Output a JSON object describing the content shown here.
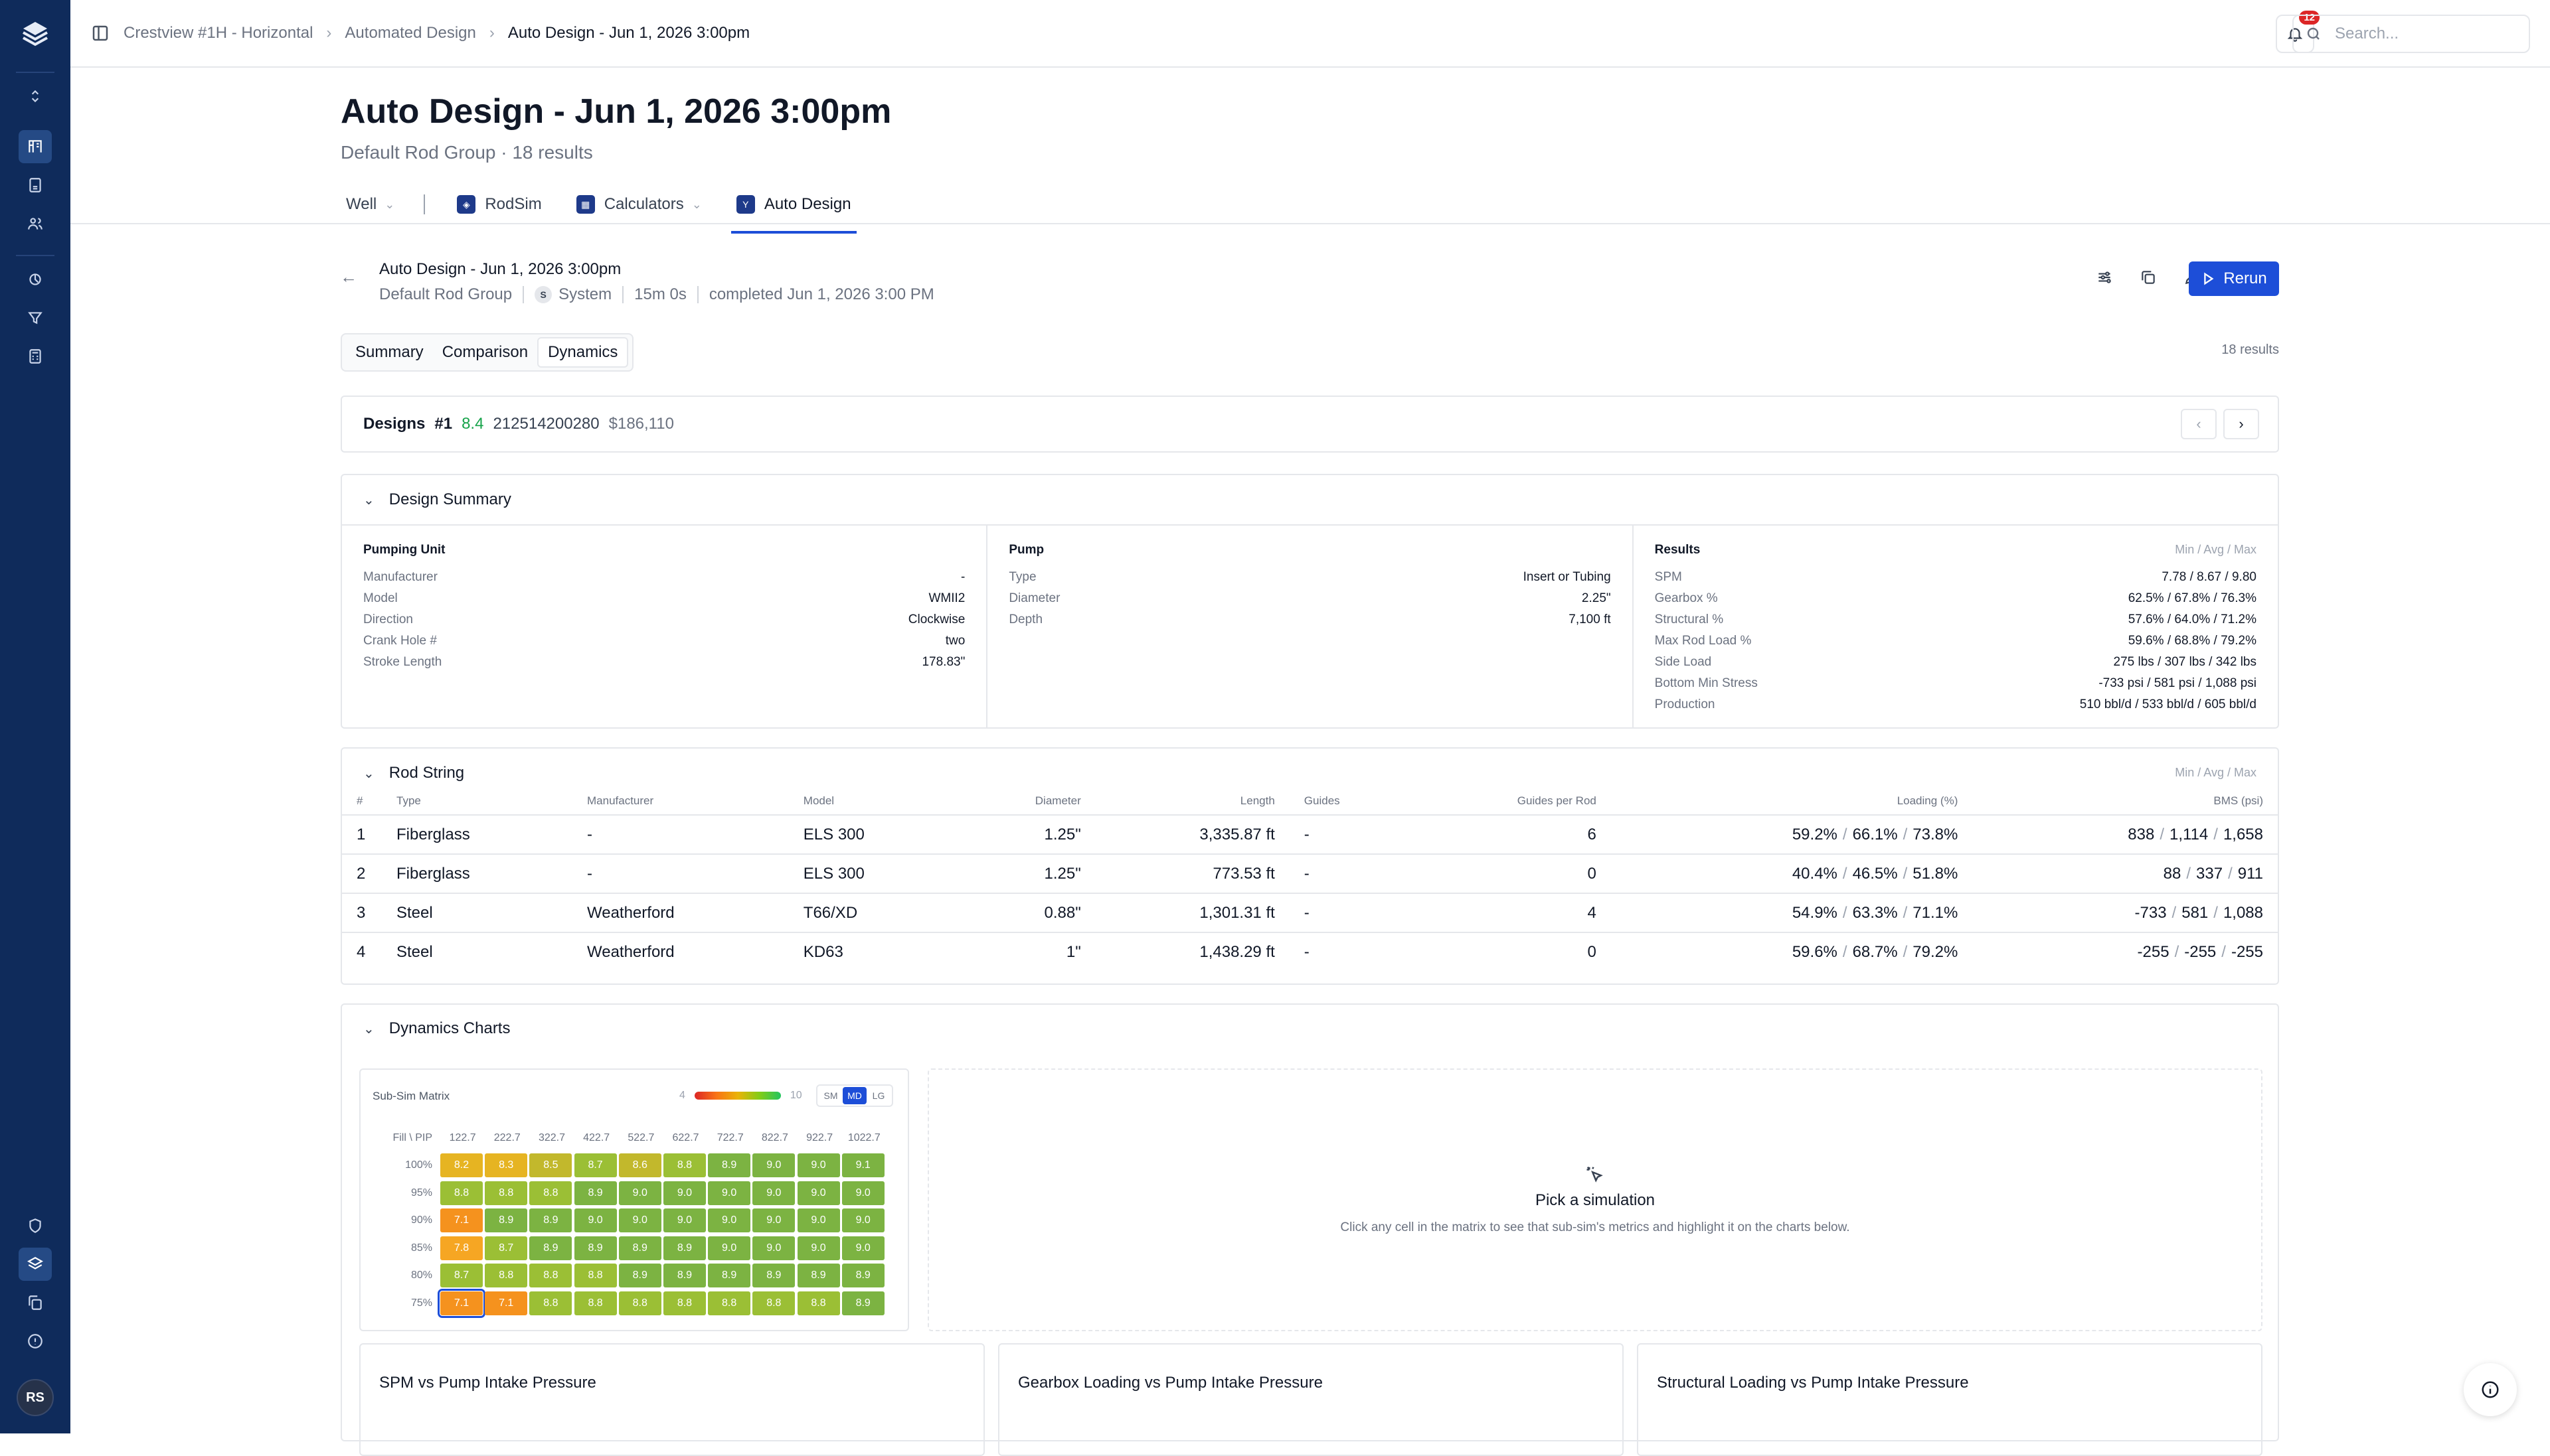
{
  "colors": {
    "brand": "#0f2b5b",
    "accent": "#1d4ed8",
    "success": "#16a34a"
  },
  "user_initials": "RS",
  "notifications": {
    "count": "12"
  },
  "search": {
    "placeholder": "Search..."
  },
  "breadcrumbs": [
    "Crestview #1H - Horizontal",
    "Automated Design",
    "Auto Design - Jun 1, 2026 3:00pm"
  ],
  "header": {
    "title": "Auto Design - Jun 1, 2026 3:00pm",
    "subtitle": "Default Rod Group · 18 results"
  },
  "nav_tabs": [
    {
      "label": "Well"
    },
    {
      "label": "RodSim"
    },
    {
      "label": "Calculators"
    },
    {
      "label": "Auto Design"
    }
  ],
  "run": {
    "title": "Auto Design - Jun 1, 2026 3:00pm",
    "group": "Default Rod Group",
    "author_badge": "S",
    "author": "System",
    "duration": "15m 0s",
    "status": "completed Jun 1, 2026 3:00 PM",
    "rerun_label": "Rerun"
  },
  "view_tabs": [
    "Summary",
    "Comparison",
    "Dynamics"
  ],
  "results_count": "18 results",
  "designs": {
    "label": "Designs",
    "rank": "#1",
    "score": "8.4",
    "id": "212514200280",
    "cost": "$186,110"
  },
  "design_summary": {
    "title": "Design Summary",
    "pumping_unit": {
      "title": "Pumping Unit",
      "rows": [
        [
          "Manufacturer",
          "-"
        ],
        [
          "Model",
          "WMII2"
        ],
        [
          "Direction",
          "Clockwise"
        ],
        [
          "Crank Hole #",
          "two"
        ],
        [
          "Stroke Length",
          "178.83\""
        ]
      ]
    },
    "pump": {
      "title": "Pump",
      "rows": [
        [
          "Type",
          "Insert or Tubing"
        ],
        [
          "Diameter",
          "2.25\""
        ],
        [
          "Depth",
          "7,100 ft"
        ]
      ]
    },
    "results": {
      "title": "Results",
      "hint": "Min / Avg / Max",
      "rows": [
        [
          "SPM",
          "7.78 / 8.67 / 9.80"
        ],
        [
          "Gearbox %",
          "62.5% / 67.8% / 76.3%"
        ],
        [
          "Structural %",
          "57.6% / 64.0% / 71.2%"
        ],
        [
          "Max Rod Load %",
          "59.6% / 68.8% / 79.2%"
        ],
        [
          "Side Load",
          "275 lbs / 307 lbs / 342 lbs"
        ],
        [
          "Bottom Min Stress",
          "-733 psi / 581 psi / 1,088 psi"
        ],
        [
          "Production",
          "510 bbl/d / 533 bbl/d / 605 bbl/d"
        ]
      ]
    }
  },
  "rod_string": {
    "title": "Rod String",
    "hint": "Min / Avg / Max",
    "headers": [
      "#",
      "Type",
      "Manufacturer",
      "Model",
      "Diameter",
      "Length",
      "Guides",
      "Guides per Rod",
      "Loading (%)",
      "BMS (psi)"
    ],
    "rows": [
      {
        "n": "1",
        "type": "Fiberglass",
        "mfr": "-",
        "model": "ELS 300",
        "dia": "1.25\"",
        "len": "3,335.87 ft",
        "guides": "-",
        "gpr": "6",
        "load": [
          "59.2%",
          "66.1%",
          "73.8%"
        ],
        "bms": [
          "838",
          "1,114",
          "1,658"
        ]
      },
      {
        "n": "2",
        "type": "Fiberglass",
        "mfr": "-",
        "model": "ELS 300",
        "dia": "1.25\"",
        "len": "773.53 ft",
        "guides": "-",
        "gpr": "0",
        "load": [
          "40.4%",
          "46.5%",
          "51.8%"
        ],
        "bms": [
          "88",
          "337",
          "911"
        ]
      },
      {
        "n": "3",
        "type": "Steel",
        "mfr": "Weatherford",
        "model": "T66/XD",
        "dia": "0.88\"",
        "len": "1,301.31 ft",
        "guides": "-",
        "gpr": "4",
        "load": [
          "54.9%",
          "63.3%",
          "71.1%"
        ],
        "bms": [
          "-733",
          "581",
          "1,088"
        ]
      },
      {
        "n": "4",
        "type": "Steel",
        "mfr": "Weatherford",
        "model": "KD63",
        "dia": "1\"",
        "len": "1,438.29 ft",
        "guides": "-",
        "gpr": "0",
        "load": [
          "59.6%",
          "68.7%",
          "79.2%"
        ],
        "bms": [
          "-255",
          "-255",
          "-255"
        ]
      }
    ]
  },
  "dynamics": {
    "title": "Dynamics Charts",
    "matrix": {
      "title": "Sub-Sim Matrix",
      "legend_min": "4",
      "legend_max": "10",
      "sizes": [
        "SM",
        "MD",
        "LG"
      ],
      "selected_size": "MD",
      "corner": "Fill \\ PIP",
      "pip": [
        "122.7",
        "222.7",
        "322.7",
        "422.7",
        "522.7",
        "622.7",
        "722.7",
        "822.7",
        "922.7",
        "1022.7"
      ],
      "rows": [
        {
          "fill": "100%",
          "v": [
            "8.2",
            "8.3",
            "8.5",
            "8.7",
            "8.6",
            "8.8",
            "8.9",
            "9.0",
            "9.0",
            "9.1"
          ]
        },
        {
          "fill": "95%",
          "v": [
            "8.8",
            "8.8",
            "8.8",
            "8.9",
            "9.0",
            "9.0",
            "9.0",
            "9.0",
            "9.0",
            "9.0"
          ]
        },
        {
          "fill": "90%",
          "v": [
            "7.1",
            "8.9",
            "8.9",
            "9.0",
            "9.0",
            "9.0",
            "9.0",
            "9.0",
            "9.0",
            "9.0"
          ]
        },
        {
          "fill": "85%",
          "v": [
            "7.8",
            "8.7",
            "8.9",
            "8.9",
            "8.9",
            "8.9",
            "9.0",
            "9.0",
            "9.0",
            "9.0"
          ]
        },
        {
          "fill": "80%",
          "v": [
            "8.7",
            "8.8",
            "8.8",
            "8.8",
            "8.9",
            "8.9",
            "8.9",
            "8.9",
            "8.9",
            "8.9"
          ]
        },
        {
          "fill": "75%",
          "v": [
            "7.1",
            "7.1",
            "8.8",
            "8.8",
            "8.8",
            "8.8",
            "8.8",
            "8.8",
            "8.8",
            "8.9"
          ]
        }
      ]
    },
    "pick": {
      "title": "Pick a simulation",
      "desc": "Click any cell in the matrix to see that sub-sim's metrics and highlight it on the charts below."
    },
    "charts": [
      "SPM vs Pump Intake Pressure",
      "Gearbox Loading vs Pump Intake Pressure",
      "Structural Loading vs Pump Intake Pressure"
    ]
  }
}
